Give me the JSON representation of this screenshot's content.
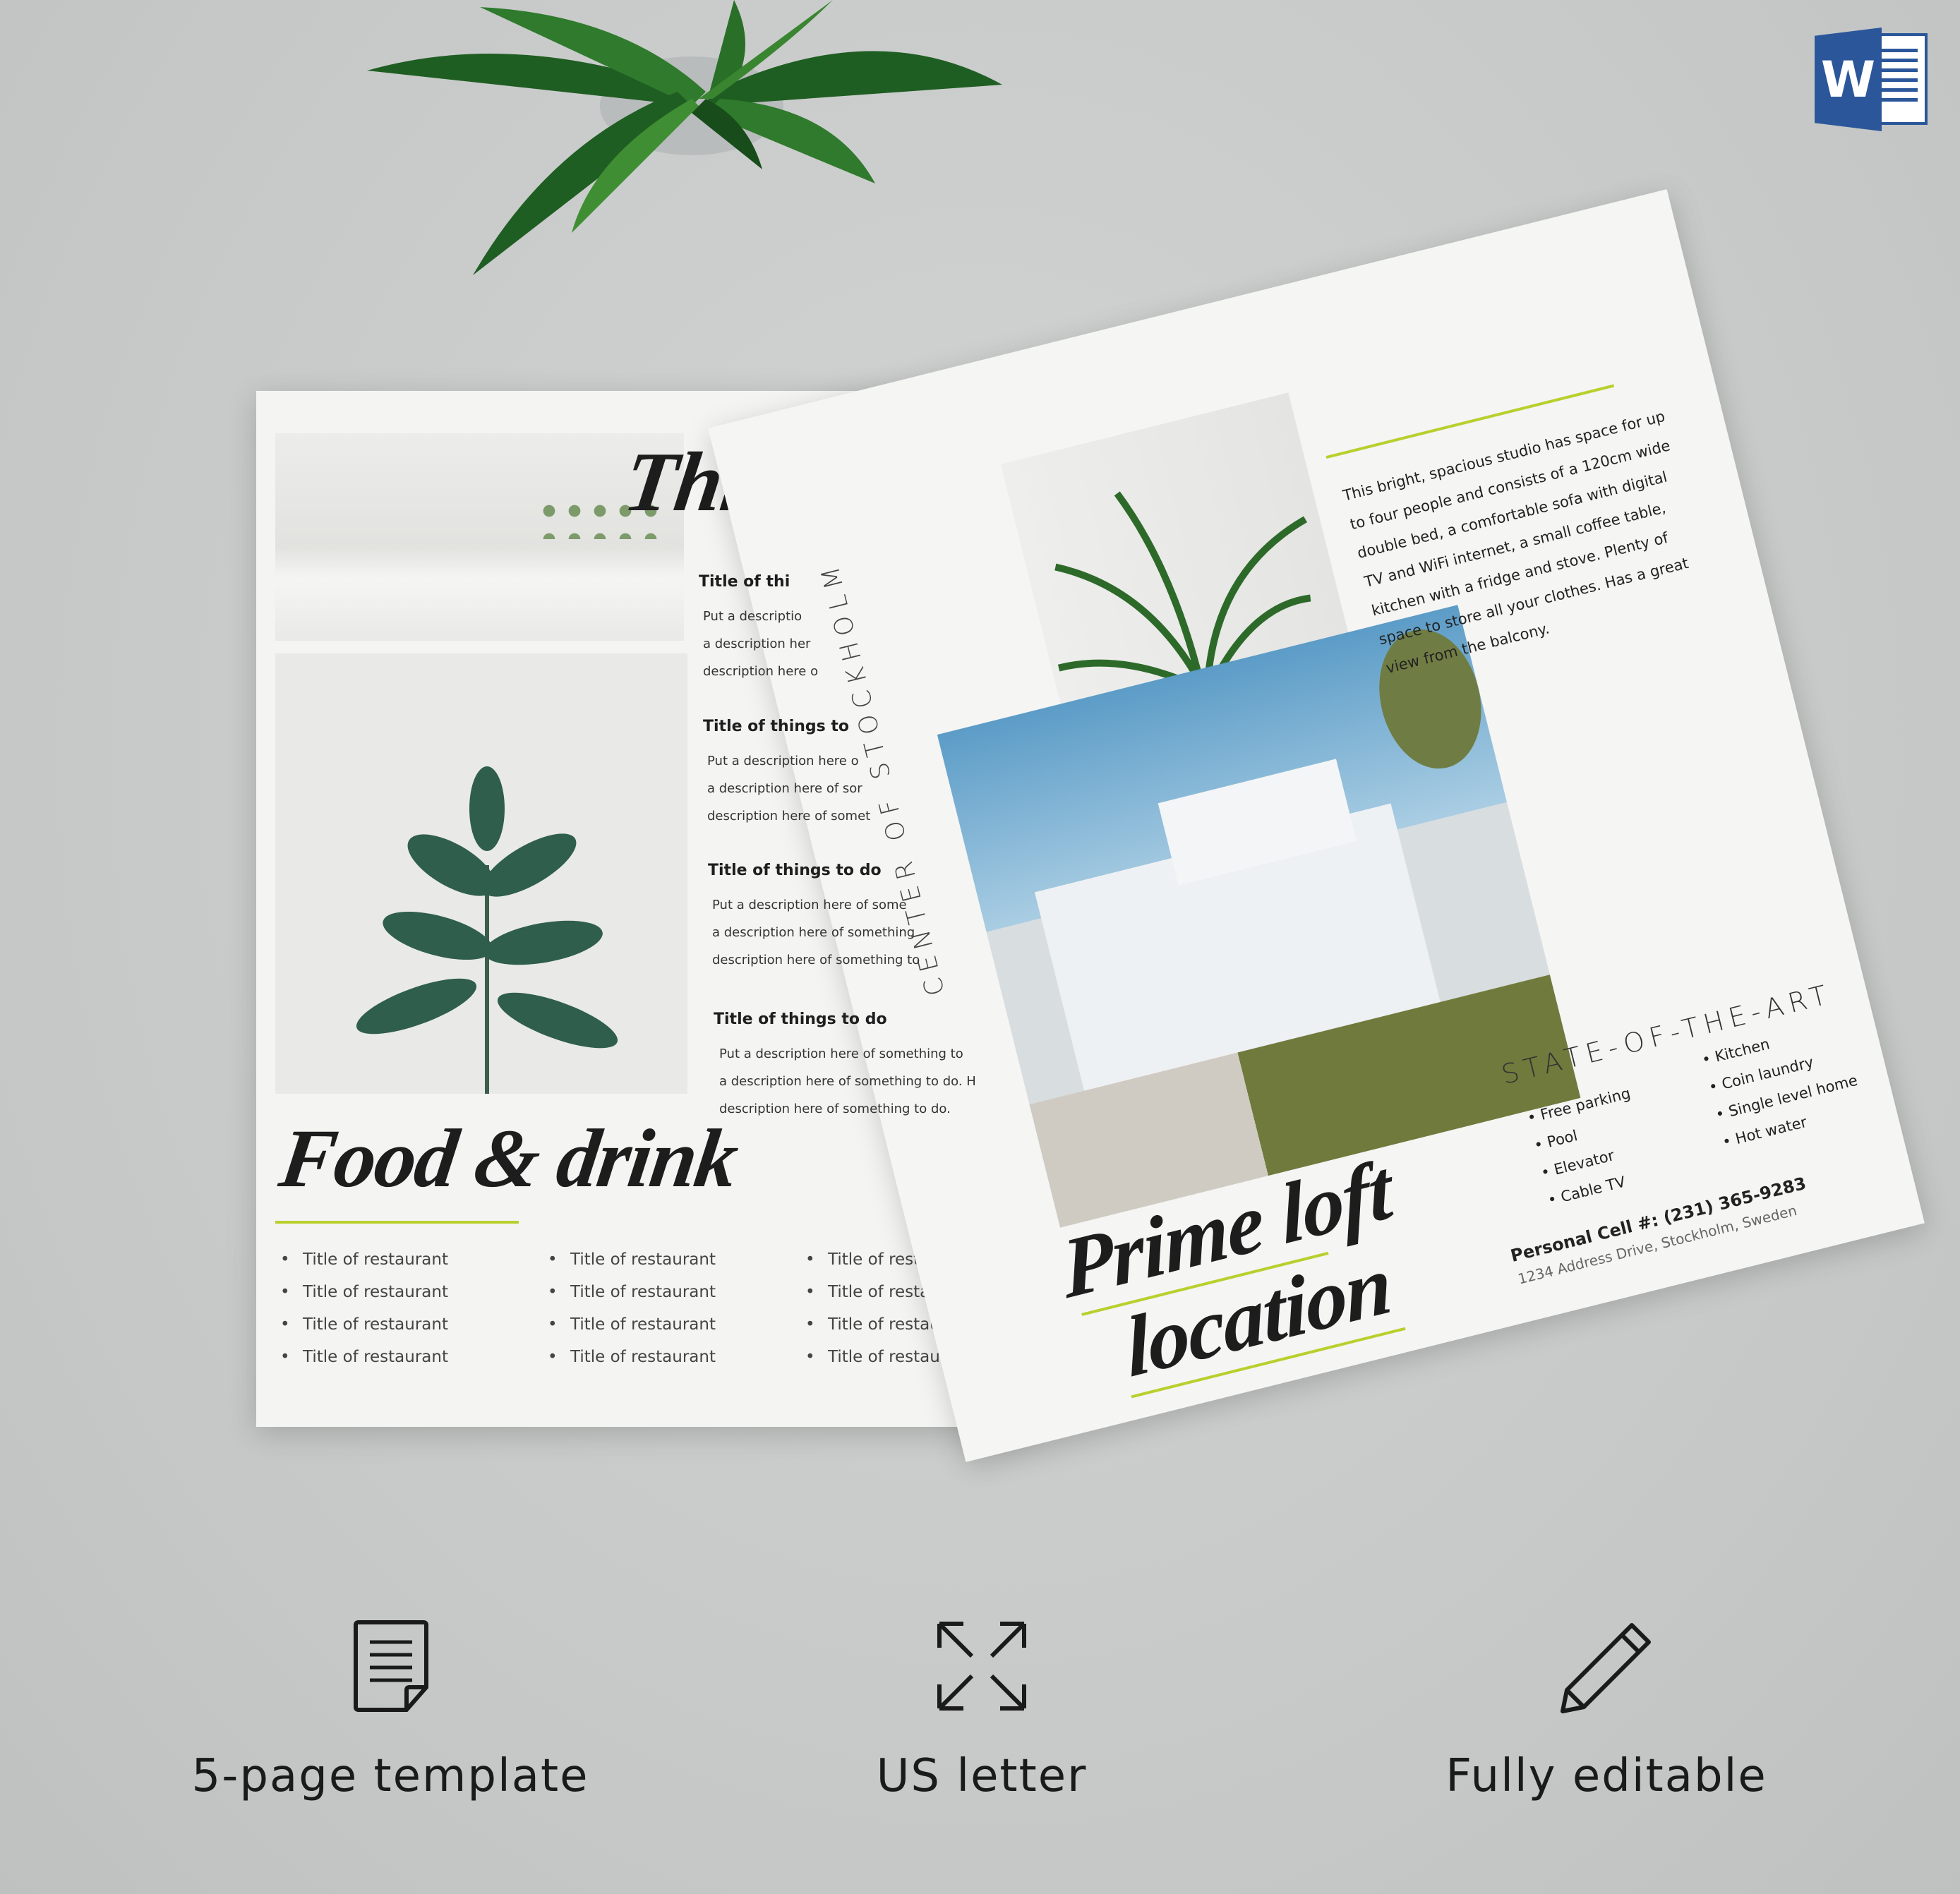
{
  "colors": {
    "accent": "#b9cf2c",
    "background": "#c9cbcb",
    "word_blue": "#2b579a"
  },
  "word_icon": {
    "letter": "W",
    "icon": "microsoft-word-icon"
  },
  "left_page": {
    "heading": "Thing",
    "things": [
      {
        "title": "Title of thi",
        "lines": [
          "Put a descriptio",
          "a description her",
          "description here o"
        ]
      },
      {
        "title": "Title of things to",
        "lines": [
          "Put a description here o",
          "a description here of sor",
          "description here of somet"
        ]
      },
      {
        "title": "Title of things to do",
        "lines": [
          "Put a description here of some",
          "a description here of something",
          "description here of something to"
        ]
      },
      {
        "title": "Title of things to do",
        "lines": [
          "Put a description here of something to",
          "a description here of something to do. H",
          "description here of something to do."
        ]
      }
    ],
    "food_heading": "Food & drink",
    "restaurants": [
      [
        "Title of restaurant",
        "Title of restaurant",
        "Title of restaurant",
        "Title of restaurant"
      ],
      [
        "Title of restaurant",
        "Title of restaurant",
        "Title of restaurant",
        "Title of restaurant"
      ],
      [
        "Title of restaurant",
        "Title of restaurant",
        "Title of restaurant",
        "Title of restaurant"
      ]
    ]
  },
  "right_page": {
    "vertical_title": "CENTER OF STOCKHOLM",
    "description": "This bright, spacious studio has space for up to four people and consists of a 120cm wide double bed, a comfortable sofa with digital TV and WiFi internet, a small coffee table, kitchen with a fridge and stove. Plenty of space to store all your clothes. Has a great view from the balcony.",
    "features_title": "STATE-OF-THE-ART",
    "features_col1": [
      "Free parking",
      "Pool",
      "Elevator",
      "Cable TV"
    ],
    "features_col2": [
      "Kitchen",
      "Coin laundry",
      "Single level home",
      "Hot water"
    ],
    "headline_line1": "Prime loft",
    "headline_line2": "location",
    "contact": "Personal Cell #: (231) 365-9283",
    "address": "1234 Address Drive, Stockholm, Sweden"
  },
  "features": [
    {
      "icon": "document-icon",
      "label": "5-page template"
    },
    {
      "icon": "expand-arrows-icon",
      "label": "US letter"
    },
    {
      "icon": "pencil-icon",
      "label": "Fully editable"
    }
  ]
}
